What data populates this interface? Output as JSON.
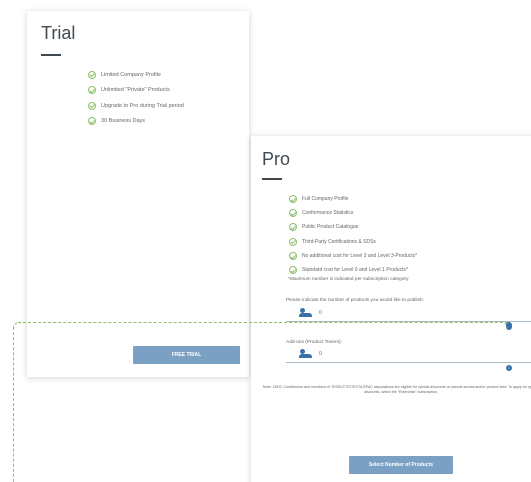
{
  "trial": {
    "title": "Trial",
    "features": [
      "Limited Company Profile",
      "Unlimited \"Private\" Products",
      "Upgrade to Pro during Trial period",
      "30 Business Days"
    ],
    "button_label": "FREE TRIAL"
  },
  "pro": {
    "title": "Pro",
    "features": [
      "Full Company Profile",
      "Conformance Statistics",
      "Public Product Catalogue",
      "Third-Party Certifications & SDSs",
      "No additional cost for Level 3 and Level 3-Products*",
      "Standard cost for Level 0 and Level 1 Products*"
    ],
    "footnote": "*Maximum number is indicated per subscription category",
    "products_question": "Please indicate the number of products you would like to publish:",
    "products_value": "0",
    "addons_label": "Add-ons (Product Toners):",
    "addons_value": "0",
    "note": "Note: ZDHC Contributors and members of TESSUTTO/TEXTILEPAC associations are eligible for special discounts on annual access and/or product fees. To apply for special discounts, select the \"Enterprise\" subscription.",
    "button_label": "Select Number of Products"
  },
  "icons": {
    "feature_check": "check-circle-icon",
    "input_prefix": "users-icon",
    "info": "info-icon"
  },
  "colors": {
    "accent_green": "#8fbf6a",
    "button_blue": "#7aa1c4",
    "icon_blue": "#3b6fa8",
    "title_dark": "#3f4a52"
  }
}
